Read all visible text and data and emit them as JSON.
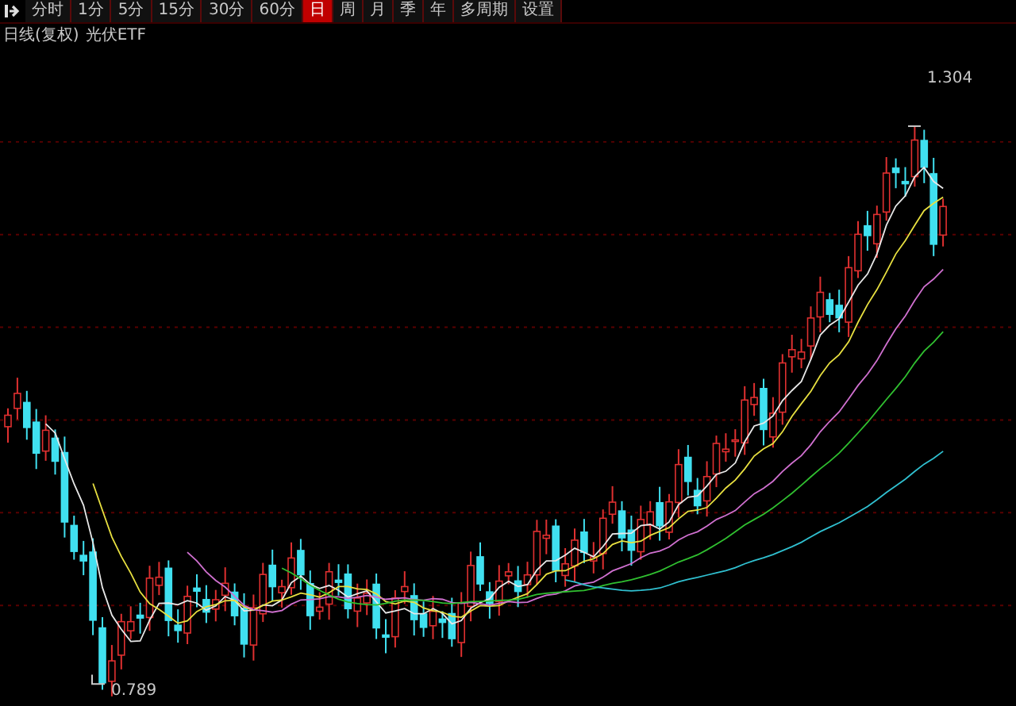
{
  "toolbar": {
    "periods": [
      {
        "label": "分时",
        "selected": false
      },
      {
        "label": "1分",
        "selected": false
      },
      {
        "label": "5分",
        "selected": false
      },
      {
        "label": "15分",
        "selected": false
      },
      {
        "label": "30分",
        "selected": false
      },
      {
        "label": "60分",
        "selected": false
      },
      {
        "label": "日",
        "selected": true
      },
      {
        "label": "周",
        "selected": false
      },
      {
        "label": "月",
        "selected": false
      },
      {
        "label": "季",
        "selected": false
      },
      {
        "label": "年",
        "selected": false
      },
      {
        "label": "多周期",
        "selected": false
      },
      {
        "label": "设置",
        "selected": false
      }
    ]
  },
  "chart": {
    "title": "日线(复权)",
    "security": "光伏ETF",
    "high_label": "1.304",
    "low_label": "0.789"
  }
}
